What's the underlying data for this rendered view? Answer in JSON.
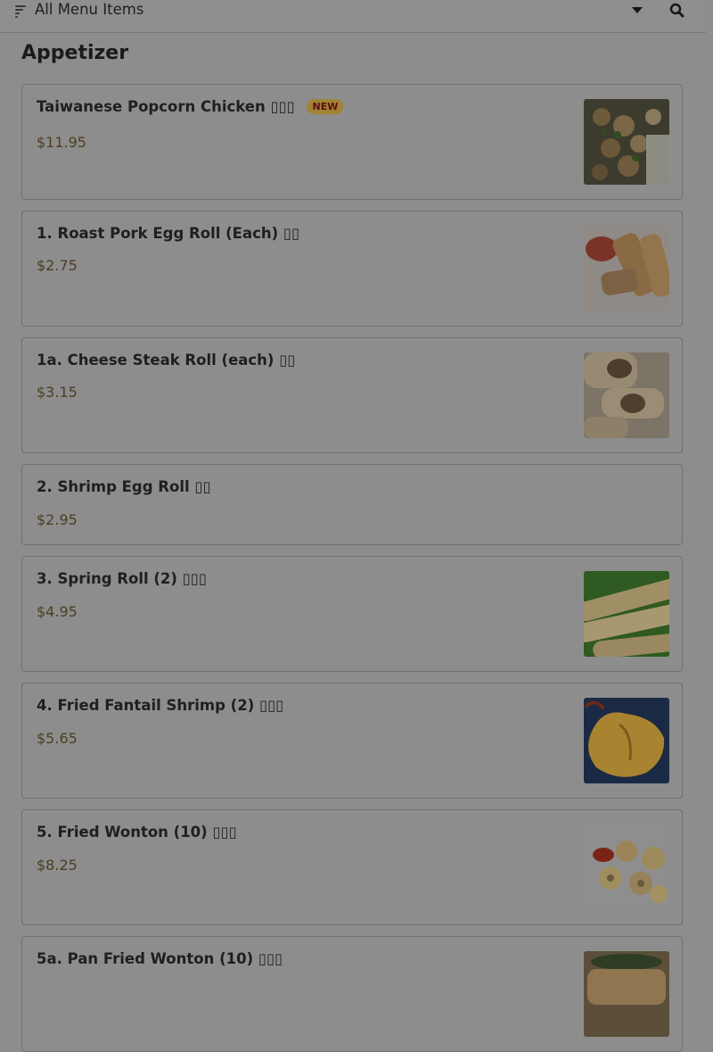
{
  "header": {
    "title": "All Menu Items"
  },
  "section": {
    "title": "Appetizer"
  },
  "items": [
    {
      "name": "Taiwanese Popcorn Chicken",
      "suffix": "▯▯▯",
      "badge": "NEW",
      "price": "$11.95",
      "has_image": true
    },
    {
      "name": "1. Roast Pork Egg Roll (Each)",
      "suffix": "▯▯",
      "price": "$2.75",
      "has_image": true
    },
    {
      "name": "1a. Cheese Steak Roll (each)",
      "suffix": "▯▯",
      "price": "$3.15",
      "has_image": true
    },
    {
      "name": "2. Shrimp Egg Roll",
      "suffix": "▯▯",
      "price": "$2.95",
      "has_image": false
    },
    {
      "name": "3. Spring Roll (2)",
      "suffix": "▯▯▯",
      "price": "$4.95",
      "has_image": true
    },
    {
      "name": "4. Fried Fantail Shrimp (2)",
      "suffix": "▯▯▯",
      "price": "$5.65",
      "has_image": true
    },
    {
      "name": "5. Fried Wonton (10)",
      "suffix": "▯▯▯",
      "price": "$8.25",
      "has_image": true
    },
    {
      "name": "5a. Pan Fried Wonton (10)",
      "suffix": "▯▯▯",
      "price": "",
      "has_image": true
    }
  ]
}
